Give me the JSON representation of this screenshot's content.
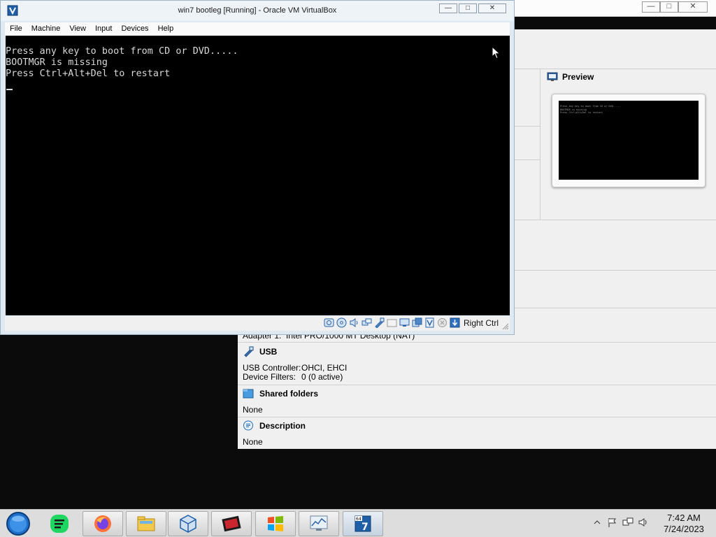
{
  "vm_window": {
    "title": "win7 bootleg [Running] - Oracle VM VirtualBox",
    "window_buttons": {
      "minimize": "—",
      "maximize": "□",
      "close": "✕"
    },
    "menu": [
      "File",
      "Machine",
      "Input",
      "View",
      "Devices",
      "Help"
    ],
    "menu_order": [
      "File",
      "Machine",
      "View",
      "Input",
      "Devices",
      "Help"
    ],
    "console_lines": [
      "Press any key to boot from CD or DVD.....",
      "BOOTMGR is missing",
      "Press Ctrl+Alt+Del to restart"
    ],
    "status_icons": [
      "hard-disk-icon",
      "optical-disk-icon",
      "audio-icon",
      "network-icon",
      "usb-icon",
      "shared-folders-icon",
      "display-icon",
      "recording-icon",
      "vt-x-icon",
      "mouse-integration-icon",
      "keyboard-capture-icon"
    ],
    "host_key": "Right Ctrl"
  },
  "manager": {
    "window_buttons": {
      "minimize": "—",
      "maximize": "□",
      "close": "✕"
    },
    "preview": {
      "title": "Preview",
      "lines": [
        "Press any key to boot from CD or DVD.....",
        "BOOTMGR is missing",
        "Press Ctrl+Alt+Del to restart"
      ]
    },
    "network_partial": {
      "key": "Adapter 1:",
      "value": "Intel PRO/1000 MT Desktop (NAT)"
    },
    "usb": {
      "title": "USB",
      "controller_key": "USB Controller:",
      "controller_value": "OHCI, EHCI",
      "filters_key": "Device Filters:",
      "filters_value": "0 (0 active)"
    },
    "shared_folders": {
      "title": "Shared folders",
      "value": "None"
    },
    "description": {
      "title": "Description",
      "value": "None"
    }
  },
  "taskbar": {
    "apps": [
      "start-orb",
      "spotify",
      "firefox",
      "file-explorer",
      "virtualbox-manager",
      "media-app",
      "windows-7",
      "resource-monitor",
      "win7-bootleg-vm"
    ],
    "clock_time": "7:42 AM",
    "clock_date": "7/24/2023"
  },
  "colors": {
    "console_bg": "#000000",
    "console_text": "#d8d8d8",
    "taskbar_bg": "#dddddd",
    "window_frame": "#dfe9f2",
    "desktop_bg": "#0b0b0b"
  }
}
